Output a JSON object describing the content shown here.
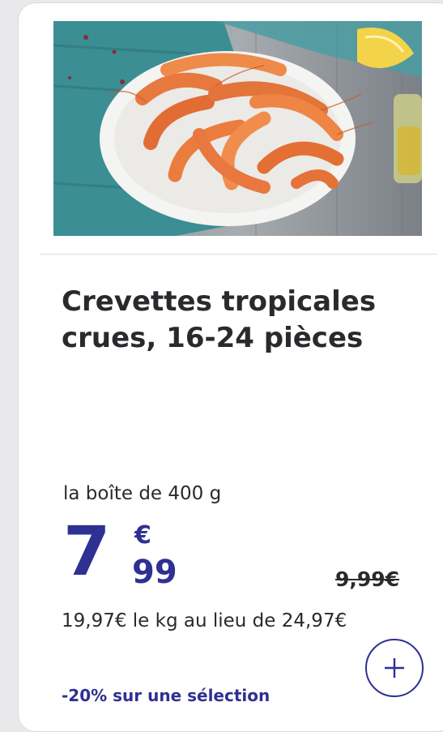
{
  "product": {
    "image_subject": "shrimp-plate-photo",
    "title": "Crevettes tropicales crues, 16-24 pièces",
    "unit": "la boîte de 400 g"
  },
  "price": {
    "integer": "7",
    "currency": "€",
    "cents": "99",
    "old_price": "9,99€",
    "per_kg": "19,97€ le kg au lieu de 24,97€"
  },
  "promo": {
    "label": "-20% sur une sélection"
  },
  "actions": {
    "add_icon": "plus-icon"
  },
  "colors": {
    "accent": "#2e3092",
    "text": "#2a2a2e"
  }
}
